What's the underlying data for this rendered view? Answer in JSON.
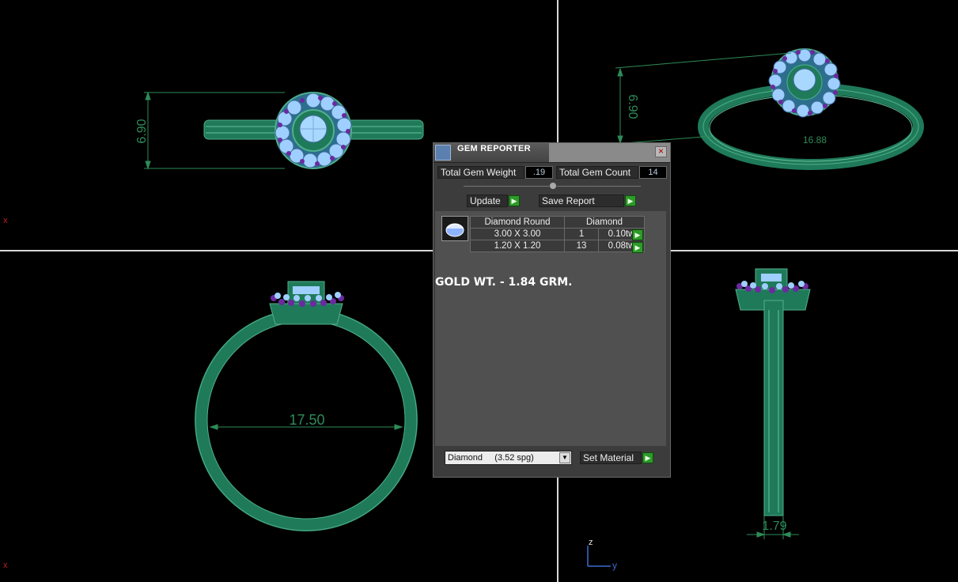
{
  "dimensions": {
    "top_view_height": "6.90",
    "iso_view_height": "6.90",
    "iso_view_partial": "16.88",
    "front_view_diameter": "17.50",
    "side_view_width": "1.79"
  },
  "axes": {
    "x_label_1": "x",
    "x_label_2": "x",
    "z_label": "z",
    "y_label": "y"
  },
  "gem_reporter": {
    "title": "GEM REPORTER",
    "close_label": "×",
    "total_weight_label": "Total Gem Weight",
    "total_weight_value": ".19",
    "total_count_label": "Total Gem Count",
    "total_count_value": "14",
    "update_label": "Update",
    "save_report_label": "Save Report",
    "table_header": [
      "Diamond Round",
      "Diamond"
    ],
    "rows": [
      {
        "size": "3.00 X 3.00",
        "count": "1",
        "weight": "0.10tw"
      },
      {
        "size": "1.20 X 1.20",
        "count": "13",
        "weight": "0.08tw"
      }
    ],
    "gold_weight_text": "GOLD WT. - 1.84 GRM.",
    "material_select": "Diamond     (3.52 spg)",
    "set_material_label": "Set Material"
  },
  "colors": {
    "metal": "#1f7a5a",
    "gem": "#8ec9ff",
    "prong": "#6b2aa0",
    "dimension": "#2e8b57"
  }
}
